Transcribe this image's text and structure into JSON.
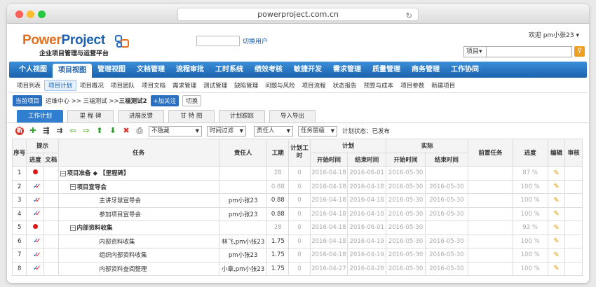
{
  "browser": {
    "url": "powerproject.com.cn"
  },
  "brand": {
    "logo_a": "Power",
    "logo_b": "Project",
    "slogan": "企业项目管理与运营平台"
  },
  "header": {
    "switch_user_label": "切换用户",
    "welcome": "欢迎 pm小张23 ▾",
    "search_scope": "项目",
    "search_value": ""
  },
  "nav": [
    "个人视图",
    "项目视图",
    "管理视图",
    "文档管理",
    "流程审批",
    "工时系统",
    "绩效考核",
    "敏捷开发",
    "需求管理",
    "质量管理",
    "商务管理",
    "工作协同"
  ],
  "nav_active": 1,
  "subnav": [
    "项目列表",
    "项目计划",
    "项目概况",
    "项目团队",
    "项目文档",
    "需求管理",
    "测试管理",
    "缺陷管理",
    "问题与风险",
    "项目流程",
    "状态报告",
    "预算与成本",
    "项目参数",
    "新建项目"
  ],
  "subnav_active": 1,
  "breadcrumb": {
    "current": "当前项目",
    "path": "运维中心 >> 三福测试 >> ",
    "project": "三福测试2",
    "follow": "+加关注",
    "switch": "切换"
  },
  "content_tabs": [
    "工作计划",
    "里 程 碑",
    "进展反馈",
    "甘 特 图",
    "计划跟踪",
    "导入导出"
  ],
  "content_tab_active": 0,
  "toolbar": {
    "filter_hide": "不隐藏",
    "filter_time": "时间过滤",
    "filter_owner": "责任人",
    "filter_level": "任务层级",
    "plan_status": "计划状态：已发布"
  },
  "table": {
    "headers": {
      "seq": "序号",
      "hint": "提示",
      "progress_hint": "进度",
      "doc_hint": "文档",
      "task": "任务",
      "owner": "责任人",
      "period": "工期",
      "plan_hours": "计划工时",
      "plan": "计划",
      "actual": "实际",
      "start": "开始时间",
      "end": "结束时间",
      "pre": "前置任务",
      "progress": "进度",
      "edit": "编辑",
      "review": "审核"
    },
    "rows": [
      {
        "seq": "1",
        "icon": "dot",
        "task": "项目准备 ◆ 【里程碑】",
        "level": 0,
        "toggle": "−",
        "bold": true,
        "owner": "",
        "period": "28",
        "hours": "0",
        "ps": "2016-04-18",
        "pe": "2016-06-01",
        "as": "2016-05-30",
        "ae": "",
        "pre": "",
        "prog": "87 %",
        "grey": true
      },
      {
        "seq": "2",
        "icon": "check",
        "task": "项目宣导会",
        "level": 1,
        "toggle": "−",
        "bold": true,
        "owner": "",
        "period": "0.88",
        "hours": "0",
        "ps": "2016-04-18",
        "pe": "2016-04-18",
        "as": "2016-05-30",
        "ae": "2016-05-30",
        "pre": "",
        "prog": "100 %",
        "grey": true
      },
      {
        "seq": "3",
        "icon": "check",
        "task": "主讲牙慧宣导会",
        "level": 2,
        "toggle": "",
        "bold": false,
        "owner": "pm小张23",
        "period": "0.88",
        "hours": "0",
        "ps": "2016-04-18",
        "pe": "2016-04-18",
        "as": "2016-05-30",
        "ae": "2016-05-30",
        "pre": "",
        "prog": "100 %",
        "grey": false
      },
      {
        "seq": "4",
        "icon": "check",
        "task": "参加项目宣导会",
        "level": 2,
        "toggle": "",
        "bold": false,
        "owner": "pm小张23",
        "period": "0.88",
        "hours": "0",
        "ps": "2016-04-18",
        "pe": "2016-04-18",
        "as": "2016-05-30",
        "ae": "2016-05-30",
        "pre": "",
        "prog": "100 %",
        "grey": false
      },
      {
        "seq": "5",
        "icon": "dot",
        "task": "内部资料收集",
        "level": 1,
        "toggle": "−",
        "bold": true,
        "owner": "",
        "period": "28",
        "hours": "0",
        "ps": "2016-04-18",
        "pe": "2016-06-01",
        "as": "2016-05-30",
        "ae": "",
        "pre": "",
        "prog": "92 %",
        "grey": true
      },
      {
        "seq": "6",
        "icon": "check",
        "task": "内部资料收集",
        "level": 2,
        "toggle": "",
        "bold": false,
        "owner": "林飞,pm小张23",
        "period": "1.75",
        "hours": "0",
        "ps": "2016-04-18",
        "pe": "2016-04-19",
        "as": "2016-05-30",
        "ae": "2016-05-30",
        "pre": "",
        "prog": "100 %",
        "grey": false
      },
      {
        "seq": "7",
        "icon": "check",
        "task": "组织内部资料收集",
        "level": 2,
        "toggle": "",
        "bold": false,
        "owner": "pm小张23",
        "period": "1.75",
        "hours": "0",
        "ps": "2016-04-18",
        "pe": "2016-04-19",
        "as": "2016-05-30",
        "ae": "2016-05-30",
        "pre": "",
        "prog": "100 %",
        "grey": false
      },
      {
        "seq": "8",
        "icon": "check",
        "task": "内部资料查阅整理",
        "level": 2,
        "toggle": "",
        "bold": false,
        "owner": "小章,pm小张23",
        "period": "1.75",
        "hours": "0",
        "ps": "2016-04-27",
        "pe": "2016-04-28",
        "as": "2016-05-30",
        "ae": "2016-05-30",
        "pre": "",
        "prog": "100 %",
        "grey": false
      }
    ]
  },
  "colors": {
    "nav_blue": "#1a62ae",
    "accent_orange": "#e4701e",
    "status_red": "#e01818"
  }
}
